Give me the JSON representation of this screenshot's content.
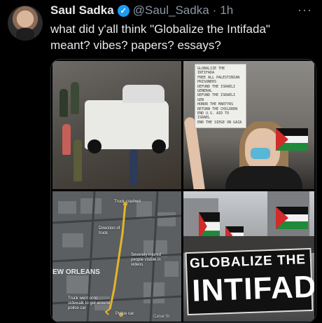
{
  "tweet": {
    "author_name": "Saul Sadka",
    "handle": "@Saul_Sadka",
    "separator": "·",
    "time": "1h",
    "text": "what did y'all think \"Globalize the Intifada\" meant? vibes? papers? essays?"
  },
  "icons": {
    "verified": "verified-badge-icon",
    "more": "more-options-icon"
  },
  "colors": {
    "background": "#000000",
    "text": "#e7e9ea",
    "muted": "#8b98a5",
    "verified": "#1d9bf0"
  },
  "media": {
    "sign_lines": [
      "GLOBALIZE THE INTIFADA",
      "FREE ALL PALESTINIAN PRISONERS",
      "DEFUND THE ISRAELI GENERAL",
      "DEFUND THE ISRAELI GEN",
      "HONOR THE MARTYRS",
      "RETURN THE CHILDREN",
      "END U.S. AID TO ISRAEL",
      "END THE SIEGE ON GAZA"
    ],
    "map": {
      "city": "EW ORLEANS",
      "truck_crashed": "Truck crashed",
      "direction": "Direction of truck",
      "injured": "Severely injured people visible in videos",
      "sidewalk": "Truck went onto sidewalk to get around police car",
      "police": "Police car",
      "street": "Canal St"
    },
    "banner": {
      "line1": "GLOBALIZE THE",
      "line2": "INTIFADA"
    }
  }
}
